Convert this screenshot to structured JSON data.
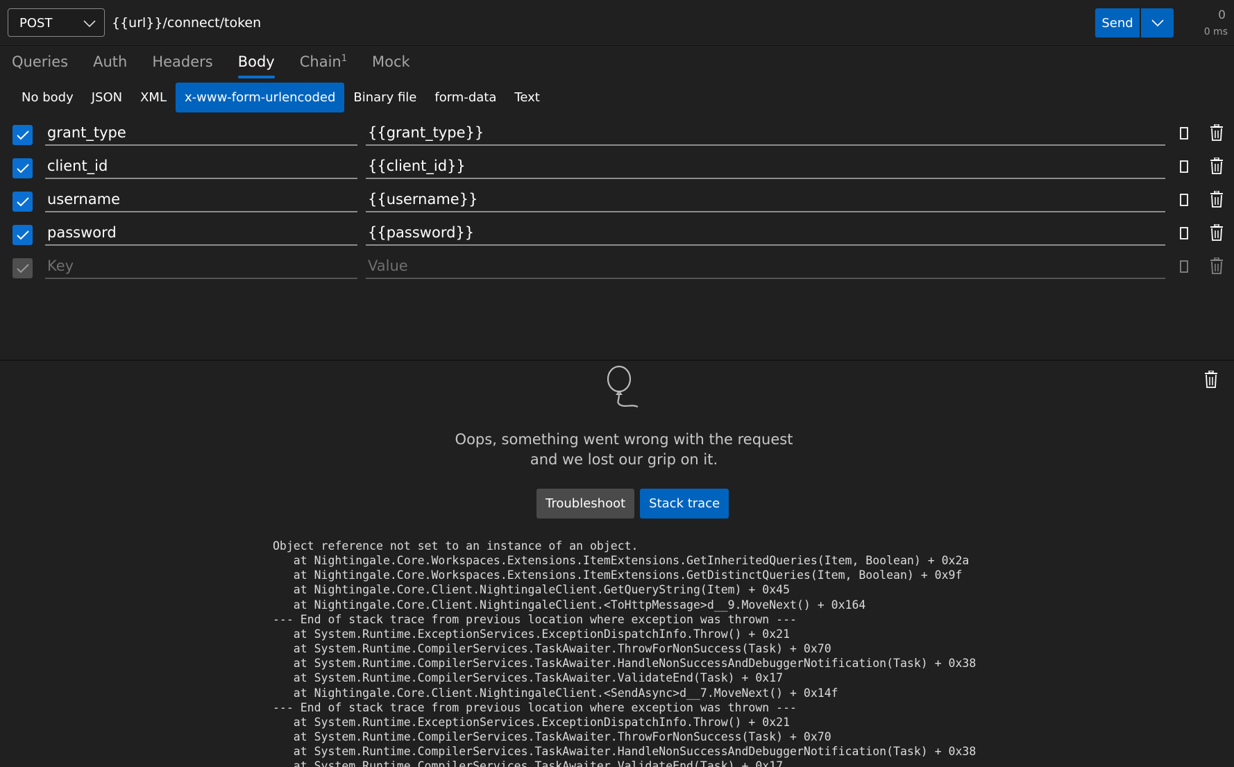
{
  "request": {
    "method": "POST",
    "url": "{{url}}/connect/token",
    "send_label": "Send",
    "status_count": "0",
    "status_time": "0 ms"
  },
  "tabs": [
    {
      "label": "Queries"
    },
    {
      "label": "Auth"
    },
    {
      "label": "Headers"
    },
    {
      "label": "Body",
      "active": true
    },
    {
      "label": "Chain",
      "badge": "1"
    },
    {
      "label": "Mock"
    }
  ],
  "body_types": [
    {
      "label": "No body"
    },
    {
      "label": "JSON"
    },
    {
      "label": "XML"
    },
    {
      "label": "x-www-form-urlencoded",
      "active": true
    },
    {
      "label": "Binary file"
    },
    {
      "label": "form-data"
    },
    {
      "label": "Text"
    }
  ],
  "form_rows": [
    {
      "key": "grant_type",
      "value": "{{grant_type}}",
      "checked": true
    },
    {
      "key": "client_id",
      "value": "{{client_id}}",
      "checked": true
    },
    {
      "key": "username",
      "value": "{{username}}",
      "checked": true
    },
    {
      "key": "password",
      "value": "{{password}}",
      "checked": true
    }
  ],
  "new_row": {
    "key_placeholder": "Key",
    "value_placeholder": "Value"
  },
  "error": {
    "line1": "Oops, something went wrong with the request",
    "line2": "and we lost our grip on it.",
    "troubleshoot_label": "Troubleshoot",
    "stack_trace_label": "Stack trace",
    "stack_trace": "Object reference not set to an instance of an object.\n   at Nightingale.Core.Workspaces.Extensions.ItemExtensions.GetInheritedQueries(Item, Boolean) + 0x2a\n   at Nightingale.Core.Workspaces.Extensions.ItemExtensions.GetDistinctQueries(Item, Boolean) + 0x9f\n   at Nightingale.Core.Client.NightingaleClient.GetQueryString(Item) + 0x45\n   at Nightingale.Core.Client.NightingaleClient.<ToHttpMessage>d__9.MoveNext() + 0x164\n--- End of stack trace from previous location where exception was thrown ---\n   at System.Runtime.ExceptionServices.ExceptionDispatchInfo.Throw() + 0x21\n   at System.Runtime.CompilerServices.TaskAwaiter.ThrowForNonSuccess(Task) + 0x70\n   at System.Runtime.CompilerServices.TaskAwaiter.HandleNonSuccessAndDebuggerNotification(Task) + 0x38\n   at System.Runtime.CompilerServices.TaskAwaiter.ValidateEnd(Task) + 0x17\n   at Nightingale.Core.Client.NightingaleClient.<SendAsync>d__7.MoveNext() + 0x14f\n--- End of stack trace from previous location where exception was thrown ---\n   at System.Runtime.ExceptionServices.ExceptionDispatchInfo.Throw() + 0x21\n   at System.Runtime.CompilerServices.TaskAwaiter.ThrowForNonSuccess(Task) + 0x70\n   at System.Runtime.CompilerServices.TaskAwaiter.HandleNonSuccessAndDebuggerNotification(Task) + 0x38\n   at System.Runtime.CompilerServices.TaskAwaiter.ValidateEnd(Task) + 0x17"
  },
  "icons": {
    "method_chevron": "chevron-down-icon",
    "send_split": "chevron-down-icon",
    "checkbox": "checkmark-icon",
    "copy": "copy-icon",
    "delete": "trash-icon",
    "empty_state": "balloon-icon"
  },
  "colors": {
    "background": "#202020",
    "accent": "#0064be",
    "checkbox": "#0a6fd1",
    "secondary_button": "#4a4a4a"
  }
}
